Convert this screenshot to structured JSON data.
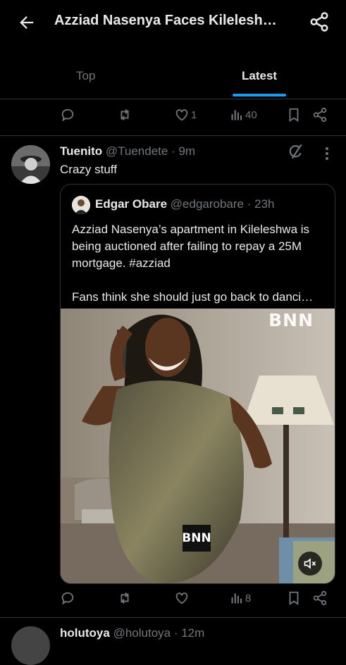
{
  "header": {
    "title": "Azziad Nasenya Faces Kilelesh…",
    "back_icon": "arrow-left-icon",
    "share_icon": "share-icon"
  },
  "tabs": [
    {
      "label": "Top",
      "active": false
    },
    {
      "label": "Latest",
      "active": true
    }
  ],
  "accent_color": "#1d9bf0",
  "prev_actions": {
    "likes": "1",
    "views": "40"
  },
  "tweet": {
    "name": "Tuenito",
    "handle": "@Tuendete",
    "time": "· 9m",
    "text": "Crazy stuff",
    "quote": {
      "name": "Edgar Obare",
      "handle": "@edgarobare",
      "time": "· 23h",
      "text_line1": "Azziad Nasenya’s apartment in Kileleshwa is being auctioned after failing to repay a 25M mortgage. #azziad",
      "text_line2": "Fans think she should just go back to danci…",
      "media": {
        "watermark_top": "BNN",
        "watermark_badge": "BNN",
        "muted": true
      }
    },
    "actions": {
      "views": "8"
    }
  },
  "next_tweet": {
    "name": "holutoya",
    "handle": "@holutoya",
    "time": "· 12m"
  }
}
